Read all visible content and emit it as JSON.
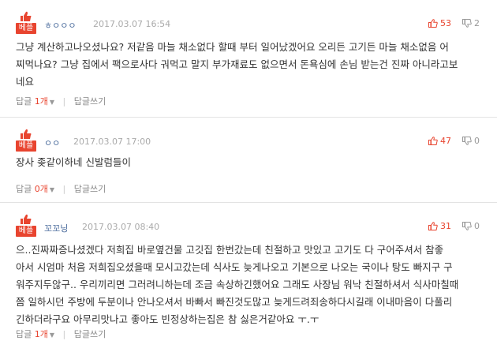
{
  "badge_label": "베플",
  "reply_label": "답글",
  "write_reply_label": "답글쓰기",
  "colors": {
    "accent": "#e8442f",
    "author": "#4a6b9c",
    "muted": "#aaaaaa"
  },
  "icons": {
    "badge": "thumbs-up-icon",
    "like": "thumbs-up-icon",
    "dislike": "thumbs-down-icon",
    "expand": "caret-down-icon"
  },
  "comments": [
    {
      "author": "ㅎㅇㅇㅇ",
      "date": "2017.03.07 16:54",
      "likes": "53",
      "dislikes": "2",
      "lines": [
        "그냥 계산하고나오셨나요? 저같음 마늘 채소없다 할때 부터 일어났겠어요 오리든 고기든 마늘 채소없음 어",
        "찌먹나요? 그냥 집에서 팩으로사다 궈먹고 말지 부가재료도 없으면서 돈욕심에 손님 받는건 진짜 아니라고보",
        "네요"
      ],
      "reply_count": "1개"
    },
    {
      "author": "ㅇㅇ",
      "date": "2017.03.07 17:00",
      "likes": "47",
      "dislikes": "0",
      "lines": [
        "장사 좆같이하네 신발럼들이"
      ],
      "reply_count": "0개"
    },
    {
      "author": "꼬꼬닝",
      "date": "2017.03.07 08:40",
      "likes": "31",
      "dislikes": "0",
      "lines": [
        "으..진짜짜증나셨겠다 저희집 바로옆건물 고깃집 한번갔는데 친절하고 맛있고 고기도 다 구어주셔서 참좋",
        "아서 시엄마 처음 저희집오셨을때 모시고갔는데 식사도 늦게나오고 기본으로 나오는 국이나 탕도 빠지구 구",
        "워주지두않구.. 우리끼리면 그러려니하는데 조금 속상하긴했어요 그래도 사장님 워낙 친절하셔서 식사마칠때",
        "쯤 일하시던 주방에 두분이나 안나오셔서 바빠서 빠진것도많고 늦게드려죄송하다시길래 이내마음이 다풀리",
        "긴하더라구요 아무리맛나고 좋아도 빈정상하는집은 참 싫은거같아요 ㅜ.ㅜ"
      ],
      "reply_count": "1개"
    }
  ]
}
